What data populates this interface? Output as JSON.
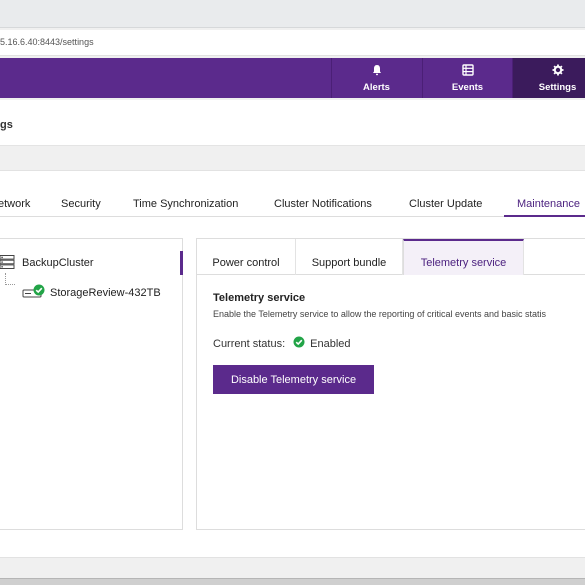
{
  "browser": {
    "url": "5.16.6.40:8443/settings"
  },
  "appbar": {
    "nav": [
      {
        "label": "Alerts",
        "icon": "bell-icon"
      },
      {
        "label": "Events",
        "icon": "list-icon"
      },
      {
        "label": "Settings",
        "icon": "gear-icon",
        "active": true
      }
    ],
    "colors": {
      "bar": "#5b2a8c",
      "active": "#3b1b5c"
    }
  },
  "page": {
    "title": "gs"
  },
  "tabs": [
    {
      "label": "etwork"
    },
    {
      "label": "Security"
    },
    {
      "label": "Time Synchronization"
    },
    {
      "label": "Cluster Notifications"
    },
    {
      "label": "Cluster Update"
    },
    {
      "label": "Maintenance",
      "active": true
    }
  ],
  "tree": {
    "items": [
      {
        "label": "BackupCluster",
        "icon": "cluster-icon",
        "selected": true
      },
      {
        "label": "StorageReview-432TB",
        "icon": "drive-icon",
        "status": "ok"
      }
    ]
  },
  "subtabs": [
    {
      "label": "Power control"
    },
    {
      "label": "Support bundle"
    },
    {
      "label": "Telemetry service",
      "active": true
    }
  ],
  "telemetry": {
    "title": "Telemetry service",
    "description": "Enable the Telemetry service to allow the reporting of critical events and basic statis",
    "status_label": "Current status:",
    "status_value": "Enabled",
    "status_color": "#22a447",
    "button_label": "Disable Telemetry service"
  }
}
